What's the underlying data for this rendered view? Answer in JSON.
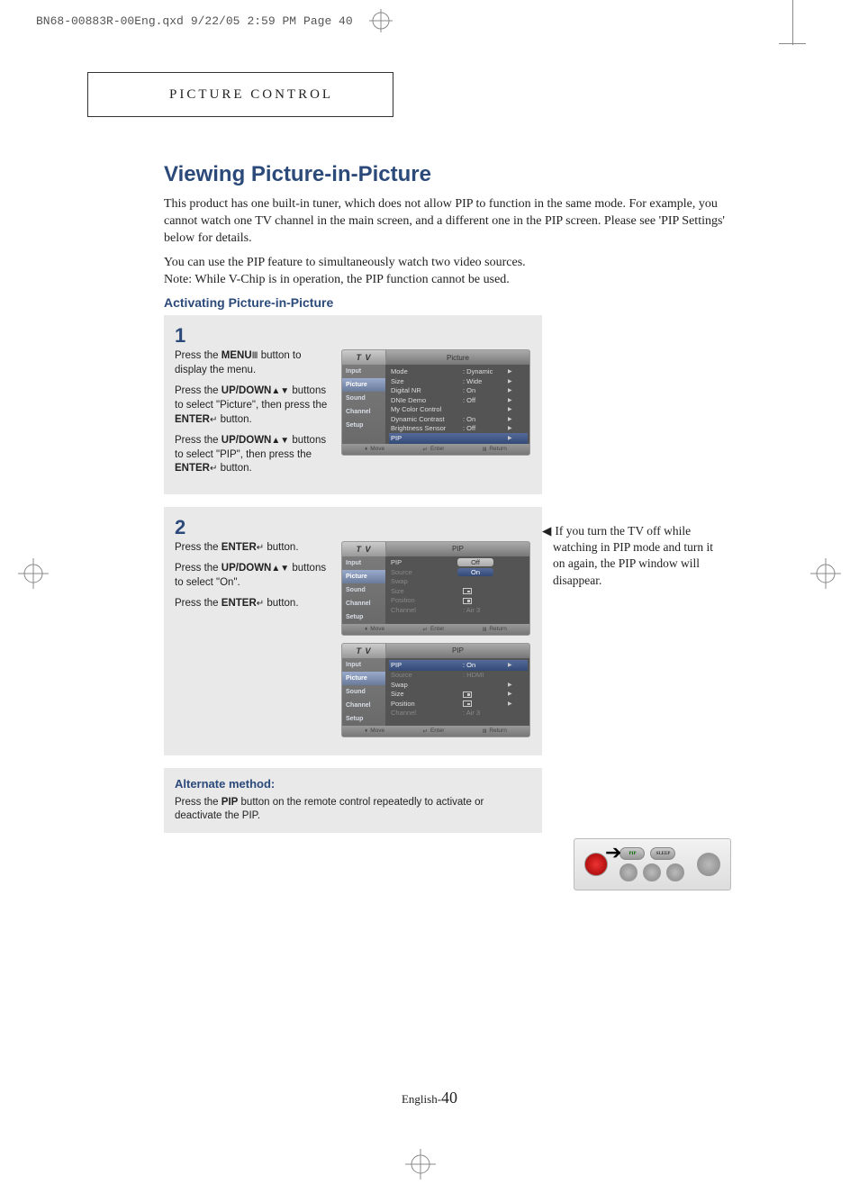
{
  "print_meta": {
    "filename": "BN68-00883R-00Eng.qxd",
    "date": "9/22/05",
    "time": "2:59 PM",
    "page": "Page 40"
  },
  "section_label": "PICTURE CONTROL",
  "title": "Viewing Picture-in-Picture",
  "intro_p1": "This product has one built-in tuner, which does not allow PIP to function in the same mode. For example, you cannot watch one TV channel in the main screen, and a different one in the PIP screen. Please see 'PIP Settings' below for details.",
  "intro_p2": "You can use the PIP feature to simultaneously watch two video sources.\nNote: While V-Chip is in operation, the PIP function cannot be used.",
  "subhead": "Activating Picture-in-Picture",
  "step1": {
    "num": "1",
    "p1a": "Press the ",
    "p1b": "MENU",
    "p1c": " button to display the menu.",
    "p2a": "Press the ",
    "p2b": "UP/DOWN",
    "p2c": " buttons to select \"Picture\", then press the ",
    "p2d": "ENTER",
    "p2e": " button.",
    "p3a": "Press the ",
    "p3b": "UP/DOWN",
    "p3c": " buttons to select \"PIP\", then press the ",
    "p3d": "ENTER",
    "p3e": " button."
  },
  "step2": {
    "num": "2",
    "p1a": "Press the ",
    "p1b": "ENTER",
    "p1c": " button.",
    "p2a": "Press the ",
    "p2b": "UP/DOWN",
    "p2c": " buttons to select \"On\".",
    "p3a": "Press the ",
    "p3b": "ENTER",
    "p3c": " button."
  },
  "note": "If you turn the TV off while watching in PIP mode and turn it on again, the PIP window will disappear.",
  "alt": {
    "head": "Alternate method:",
    "text_a": "Press the ",
    "text_b": "PIP",
    "text_c": " button on the remote control repeatedly to activate or deactivate the PIP."
  },
  "osd_common": {
    "tv": "T V",
    "side": [
      "Input",
      "Picture",
      "Sound",
      "Channel",
      "Setup"
    ],
    "foot_move": "Move",
    "foot_enter": "Enter",
    "foot_return": "Return"
  },
  "osd1": {
    "title": "Picture",
    "rows": [
      {
        "lab": "Mode",
        "val": ": Dynamic",
        "arr": "▶"
      },
      {
        "lab": "Size",
        "val": ": Wide",
        "arr": "▶"
      },
      {
        "lab": "Digital NR",
        "val": ": On",
        "arr": "▶"
      },
      {
        "lab": "DNIe Demo",
        "val": ": Off",
        "arr": "▶"
      },
      {
        "lab": "My Color Control",
        "val": "",
        "arr": "▶"
      },
      {
        "lab": "Dynamic Contrast",
        "val": ": On",
        "arr": "▶"
      },
      {
        "lab": "Brightness Sensor",
        "val": ": Off",
        "arr": "▶"
      },
      {
        "lab": "PIP",
        "val": "",
        "arr": "▶",
        "hi": true
      }
    ]
  },
  "osd2": {
    "title": "PIP",
    "rows": [
      {
        "lab": "PIP",
        "val": "Off",
        "popup": true
      },
      {
        "lab": "Source",
        "val": "On",
        "popup2": true,
        "dim": true
      },
      {
        "lab": "Swap",
        "val": "",
        "dim": true
      },
      {
        "lab": "Size",
        "val": "□",
        "dim": true
      },
      {
        "lab": "Position",
        "val": "□",
        "dim": true
      },
      {
        "lab": "Channel",
        "val": ": Air   3",
        "dim": true
      }
    ]
  },
  "osd3": {
    "title": "PIP",
    "rows": [
      {
        "lab": "PIP",
        "val": ": On",
        "arr": "▶",
        "hi": true
      },
      {
        "lab": "Source",
        "val": ": HDMI",
        "dim": true
      },
      {
        "lab": "Swap",
        "val": "",
        "arr": "▶"
      },
      {
        "lab": "Size",
        "val": "□",
        "arr": "▶"
      },
      {
        "lab": "Position",
        "val": "□",
        "arr": "▶"
      },
      {
        "lab": "Channel",
        "val": ": Air   3",
        "dim": true
      }
    ]
  },
  "remote": {
    "btn1": "PIP",
    "btn2": "SLEEP"
  },
  "footer": {
    "lang": "English-",
    "page": "40"
  }
}
